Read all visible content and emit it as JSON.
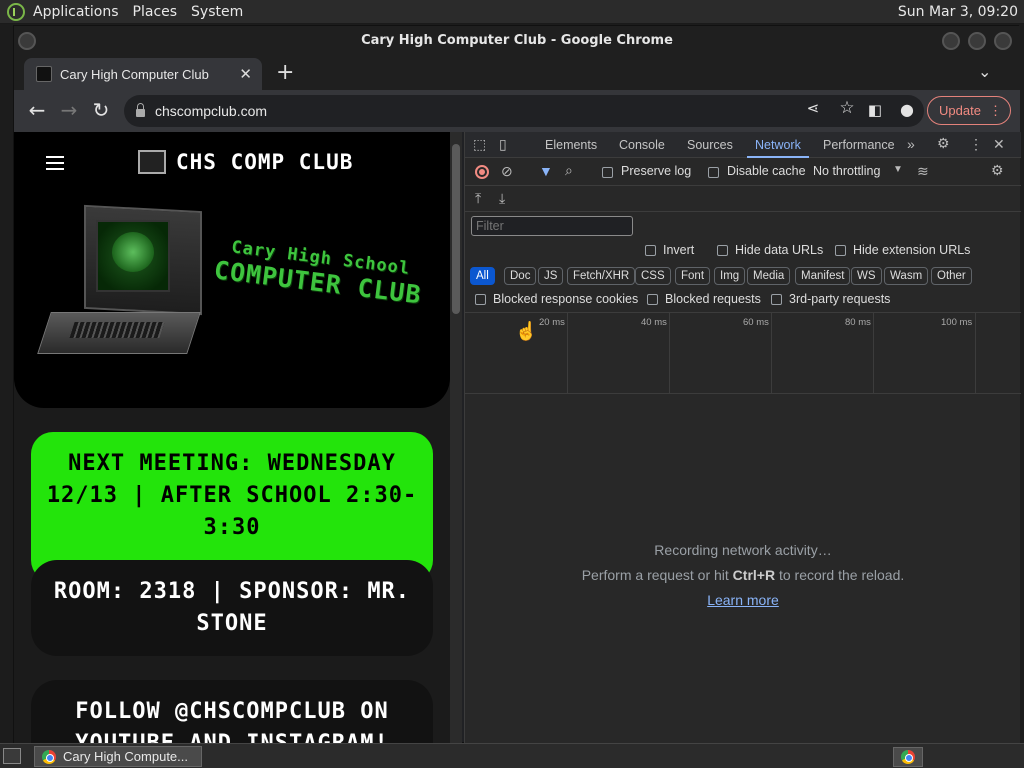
{
  "top_panel": {
    "menus": [
      "Applications",
      "Places",
      "System"
    ],
    "clock": "Sun Mar  3, 09:20"
  },
  "window": {
    "title": "Cary High Computer Club - Google Chrome"
  },
  "tab": {
    "title": "Cary High Computer Club",
    "close": "✕",
    "new_tab": "+"
  },
  "toolbar": {
    "url": "chscompclub.com",
    "update_label": "Update"
  },
  "site": {
    "title": "CHS COMP CLUB",
    "hero_line1": "Cary High School",
    "hero_line2": "COMPUTER CLUB",
    "meeting": "NEXT MEETING: WEDNESDAY 12/13 | AFTER SCHOOL 2:30-3:30",
    "room": "ROOM: 2318 | SPONSOR: MR. STONE",
    "follow": "FOLLOW @CHSCOMPCLUB ON YOUTUBE AND INSTAGRAM!"
  },
  "devtools": {
    "tabs": [
      "Elements",
      "Console",
      "Sources",
      "Network",
      "Performance"
    ],
    "active_tab": "Network",
    "preserve_log": "Preserve log",
    "disable_cache": "Disable cache",
    "throttling": "No throttling",
    "filter_placeholder": "Filter",
    "invert": "Invert",
    "hide_data_urls": "Hide data URLs",
    "hide_extension_urls": "Hide extension URLs",
    "filter_chips": [
      "All",
      "Doc",
      "JS",
      "Fetch/XHR",
      "CSS",
      "Font",
      "Img",
      "Media",
      "Manifest",
      "WS",
      "Wasm",
      "Other"
    ],
    "blocked_response_cookies": "Blocked response cookies",
    "blocked_requests": "Blocked requests",
    "third_party_requests": "3rd-party requests",
    "timeline_ticks": [
      "20 ms",
      "40 ms",
      "60 ms",
      "80 ms",
      "100 ms"
    ],
    "empty_line1": "Recording network activity…",
    "empty_line2_pre": "Perform a request or hit ",
    "empty_line2_key": "Ctrl+R",
    "empty_line2_post": " to record the reload.",
    "learn_more": "Learn more"
  },
  "taskbar": {
    "item": "Cary High Compute..."
  },
  "colors": {
    "accent_green": "#23e40b",
    "devtools_blue": "#8ab4f8",
    "update_red": "#f28b82"
  }
}
